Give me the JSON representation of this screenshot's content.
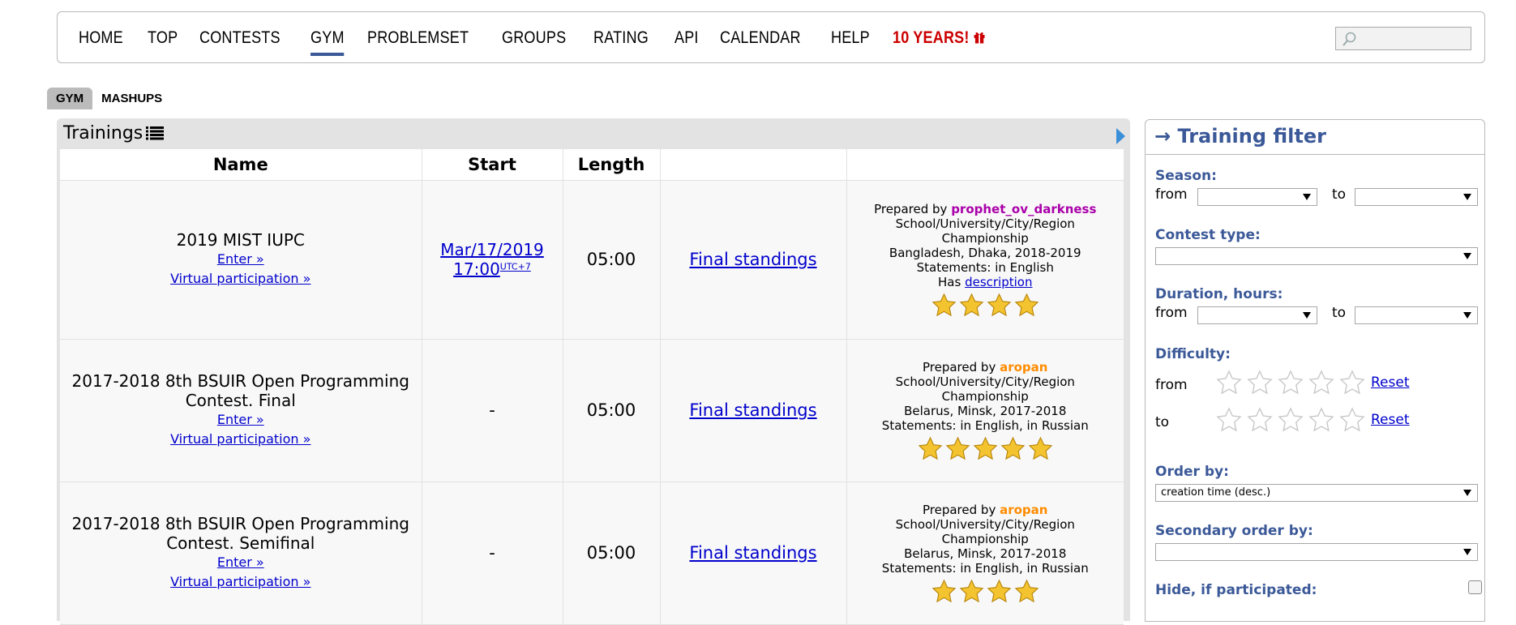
{
  "nav": {
    "items": [
      "HOME",
      "TOP",
      "CONTESTS",
      "GYM",
      "PROBLEMSET",
      "GROUPS",
      "RATING",
      "API",
      "CALENDAR",
      "HELP"
    ],
    "special": "10 YEARS!",
    "active": "GYM",
    "search_value": ""
  },
  "subtabs": [
    "GYM",
    "MASHUPS"
  ],
  "trainings": {
    "title": "Trainings",
    "columns": [
      "Name",
      "Start",
      "Length",
      "",
      ""
    ],
    "rows": [
      {
        "name": "2019 MIST IUPC",
        "enter": "Enter »",
        "virtual": "Virtual participation »",
        "start_date": "Mar/17/2019",
        "start_time": "17:00",
        "start_tz": "UTC+7",
        "length": "05:00",
        "standings": "Final standings",
        "prepared_by": "Prepared by",
        "author": "prophet_ov_darkness",
        "type": "School/University/City/Region Championship",
        "location": "Bangladesh, Dhaka, 2018-2019",
        "statements": "Statements: in English",
        "has": "Has",
        "description_link": "description",
        "difficulty": 4
      },
      {
        "name": "2017-2018 8th BSUIR Open Programming Contest. Final",
        "enter": "Enter »",
        "virtual": "Virtual participation »",
        "start_dash": "-",
        "length": "05:00",
        "standings": "Final standings",
        "prepared_by": "Prepared by",
        "author": "aropan",
        "type": "School/University/City/Region Championship",
        "location": "Belarus, Minsk, 2017-2018",
        "statements": "Statements: in English, in Russian",
        "difficulty": 5
      },
      {
        "name": "2017-2018 8th BSUIR Open Programming Contest. Semifinal",
        "enter": "Enter »",
        "virtual": "Virtual participation »",
        "start_dash": "-",
        "length": "05:00",
        "standings": "Final standings",
        "prepared_by": "Prepared by",
        "author": "aropan",
        "type": "School/University/City/Region Championship",
        "location": "Belarus, Minsk, 2017-2018",
        "statements": "Statements: in English, in Russian",
        "difficulty": 4
      }
    ]
  },
  "filter": {
    "title": "→ Training filter",
    "season_label": "Season:",
    "from": "from",
    "to": "to",
    "season_from": "",
    "season_to": "",
    "contest_type_label": "Contest type:",
    "contest_type": "",
    "duration_label": "Duration, hours:",
    "duration_from": "",
    "duration_to": "",
    "difficulty_label": "Difficulty:",
    "reset": "Reset",
    "order_label": "Order by:",
    "order_value": "creation time (desc.)",
    "secondary_label": "Secondary order by:",
    "secondary_value": "",
    "hide_label": "Hide, if participated:",
    "hide_checked": false
  },
  "colors": {
    "brand": "#3b5998",
    "link": "#0000cc",
    "special": "#cc0000",
    "author_violet": "#aa00aa",
    "author_orange": "#ff8c00",
    "star": "#f4c430"
  }
}
